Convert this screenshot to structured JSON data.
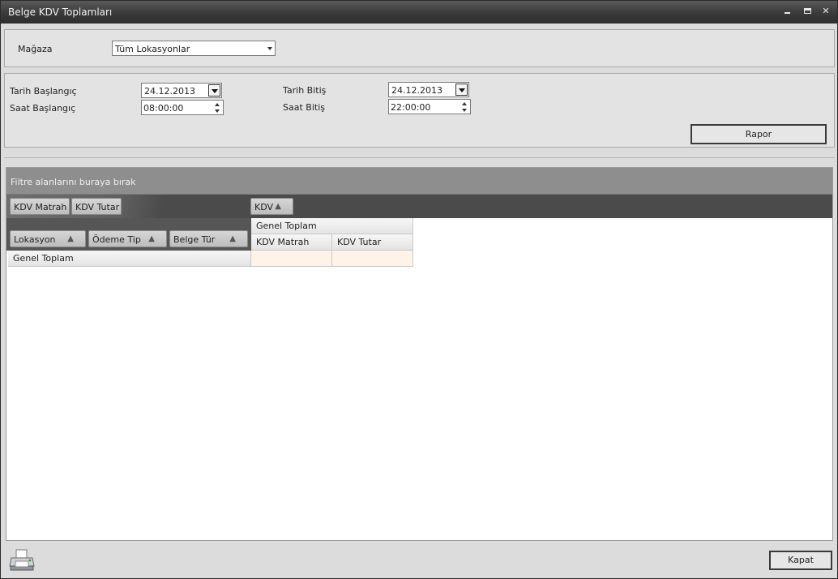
{
  "window": {
    "title": "Belge KDV Toplamları"
  },
  "store": {
    "label": "Mağaza",
    "value": "Tüm Lokasyonlar"
  },
  "dates": {
    "start_date_label": "Tarih Başlangıç",
    "start_date_value": "24.12.2013",
    "start_time_label": "Saat Başlangıç",
    "start_time_value": "08:00:00",
    "end_date_label": "Tarih Bitiş",
    "end_date_value": "24.12.2013",
    "end_time_label": "Saat Bitiş",
    "end_time_value": "22:00:00"
  },
  "actions": {
    "report_label": "Rapor",
    "close_label": "Kapat"
  },
  "pivot": {
    "filter_hint": "Filtre alanlarını buraya bırak",
    "data_fields": [
      "KDV Matrah",
      "KDV Tutar"
    ],
    "column_field": "KDV",
    "row_fields": [
      "Lokasyon",
      "Ödeme Tip",
      "Belge Tür"
    ],
    "grand_total_label": "Genel Toplam",
    "column_grand_total": "Genel Toplam",
    "value_headers": [
      "KDV Matrah",
      "KDV Tutar"
    ],
    "sort_glyph": "▲"
  },
  "icons": {
    "printer": "printer-icon"
  }
}
